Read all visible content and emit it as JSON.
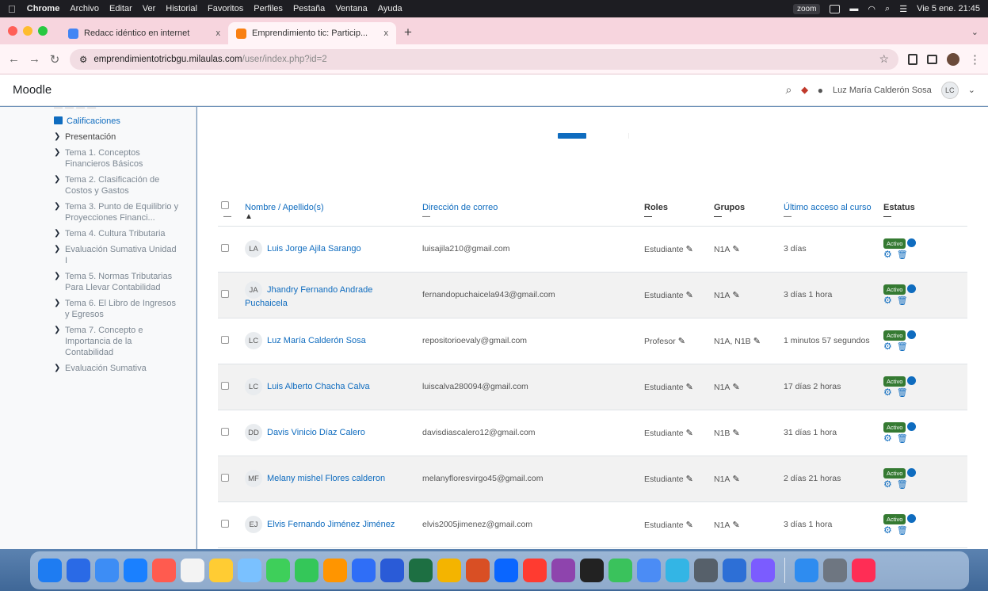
{
  "menubar": {
    "apple_icon": "apple-logo",
    "items": [
      "Chrome",
      "Archivo",
      "Editar",
      "Ver",
      "Historial",
      "Favoritos",
      "Perfiles",
      "Pestaña",
      "Ventana",
      "Ayuda"
    ],
    "zoom": "zoom",
    "datetime": "Vie 5 ene. 21:45"
  },
  "browser": {
    "tabs": [
      {
        "title": "Redacc idéntico en internet",
        "favicon": "doc-icon",
        "close": "x"
      },
      {
        "title": "Emprendimiento tic: Particip...",
        "favicon": "moodle-icon",
        "close": "x"
      }
    ],
    "new_tab": "+",
    "tab_menu": "⌄",
    "url_host": "emprendimientotricbgu.milaulas.com",
    "url_path": "/user/index.php?id=2"
  },
  "navbar": {
    "brand": "Moodle",
    "user_name": "Luz María Calderón Sosa",
    "user_initials": "LC"
  },
  "drawer": {
    "calificaciones": "Calificaciones",
    "items": [
      "Presentación",
      "Tema 1. Conceptos Financieros Básicos",
      "Tema 2. Clasificación de Costos y Gastos",
      "Tema 3. Punto de Equilibrio y Proyecciones Financi...",
      "Tema 4. Cultura Tributaria",
      "Evaluación Sumativa Unidad I",
      "Tema 5. Normas Tributarias Para Llevar Contabilidad",
      "Tema 6. El Libro de Ingresos y Egresos",
      "Tema 7. Concepto e Importancia de la Contabilidad",
      "Evaluación Sumativa"
    ]
  },
  "table": {
    "headers": {
      "name": "Nombre / Apellido(s)",
      "email": "Dirección de correo",
      "roles": "Roles",
      "groups": "Grupos",
      "last_access": "Último acceso al curso",
      "status": "Estatus"
    },
    "sort_arrow": "▲",
    "dash": "—",
    "status_label": "Activo",
    "rows": [
      {
        "initials": "LA",
        "name": "Luis Jorge Ajila Sarango",
        "email": "luisajila210@gmail.com",
        "role": "Estudiante",
        "group": "N1A",
        "last_access": "3 días"
      },
      {
        "initials": "JA",
        "name": "Jhandry Fernando Andrade Puchaicela",
        "email": "fernandopuchaicela943@gmail.com",
        "role": "Estudiante",
        "group": "N1A",
        "last_access": "3 días 1 hora"
      },
      {
        "initials": "LC",
        "name": "Luz María Calderón Sosa",
        "email": "repositorioevaly@gmail.com",
        "role": "Profesor",
        "group": "N1A, N1B",
        "last_access": "1 minutos 57 segundos"
      },
      {
        "initials": "LC",
        "name": "Luis Alberto Chacha Calva",
        "email": "luiscalva280094@gmail.com",
        "role": "Estudiante",
        "group": "N1A",
        "last_access": "17 días 2 horas"
      },
      {
        "initials": "DD",
        "name": "Davis Vinicio Díaz Calero",
        "email": "davisdiascalero12@gmail.com",
        "role": "Estudiante",
        "group": "N1B",
        "last_access": "31 días 1 hora"
      },
      {
        "initials": "MF",
        "name": "Melany mishel Flores calderon",
        "email": "melanyfloresvirgo45@gmail.com",
        "role": "Estudiante",
        "group": "N1A",
        "last_access": "2 días 21 horas"
      },
      {
        "initials": "EJ",
        "name": "Elvis Fernando Jiménez Jiménez",
        "email": "elvis2005jimenez@gmail.com",
        "role": "Estudiante",
        "group": "N1A",
        "last_access": "3 días 1 hora"
      }
    ]
  },
  "colors": {
    "accent": "#0f6cbf",
    "status_active": "#357a32",
    "tab_strip": "#f7d5de"
  }
}
